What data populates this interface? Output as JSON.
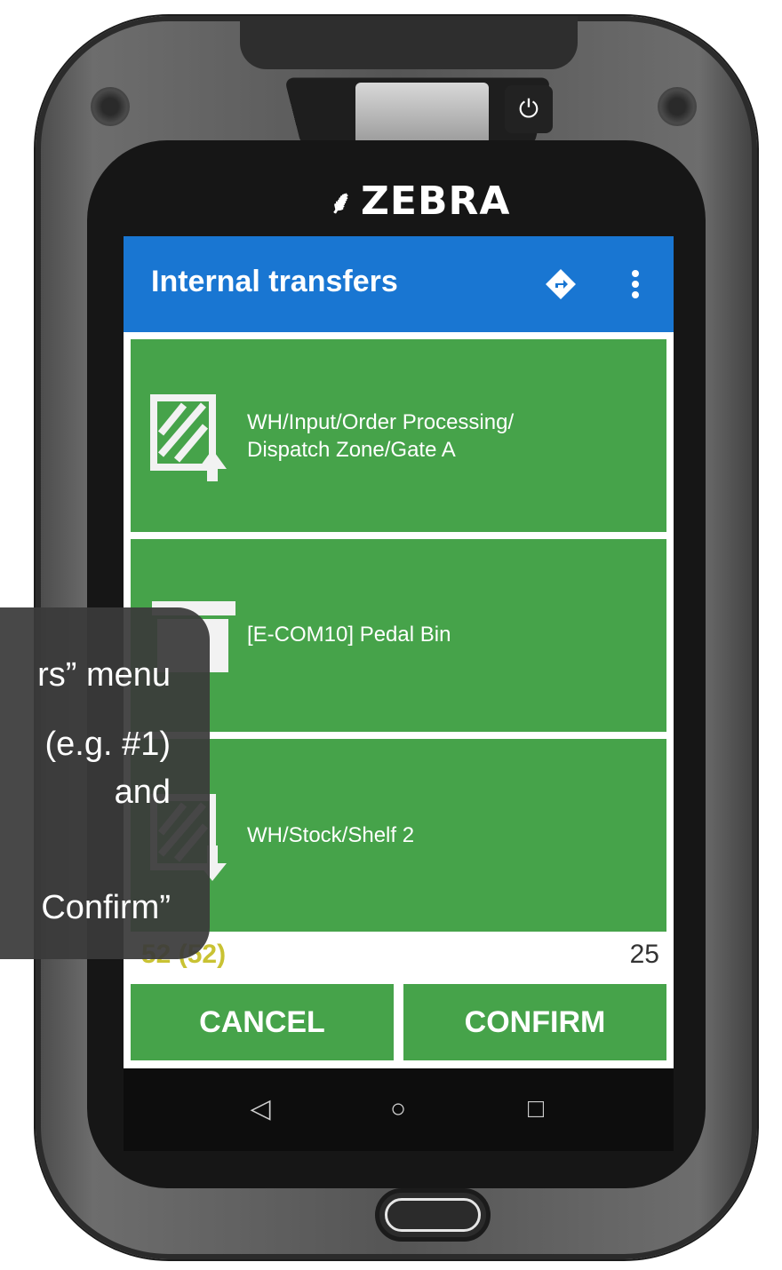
{
  "device": {
    "brand": "ZEBRA",
    "power_icon": "power-icon"
  },
  "appbar": {
    "title": "Internal transfers",
    "nav_icon": "direction-sign-icon",
    "menu_icon": "more-vert-icon"
  },
  "cards": [
    {
      "icon": "location-source-icon",
      "line1": "WH/Input/Order Processing/",
      "line2": "Dispatch Zone/Gate A"
    },
    {
      "icon": "product-box-icon",
      "line1": "[E-COM10] Pedal Bin",
      "line2": ""
    },
    {
      "icon": "location-destination-icon",
      "line1": "WH/Stock/Shelf 2",
      "line2": ""
    }
  ],
  "quantity": {
    "available": "52 (52)",
    "entered": "25"
  },
  "buttons": {
    "cancel": "CANCEL",
    "confirm": "CONFIRM"
  },
  "system_nav": {
    "back": "back-icon",
    "home": "home-icon",
    "recents": "recents-icon"
  },
  "tooltip": {
    "lines": [
      "rs” menu",
      "(e.g. #1)",
      "and",
      "",
      "Confirm”"
    ]
  },
  "colors": {
    "appbar": "#1976d2",
    "card_green": "#46a34a",
    "qty_yellow": "#c9c233",
    "tooltip_bg": "#3a3a3a"
  }
}
